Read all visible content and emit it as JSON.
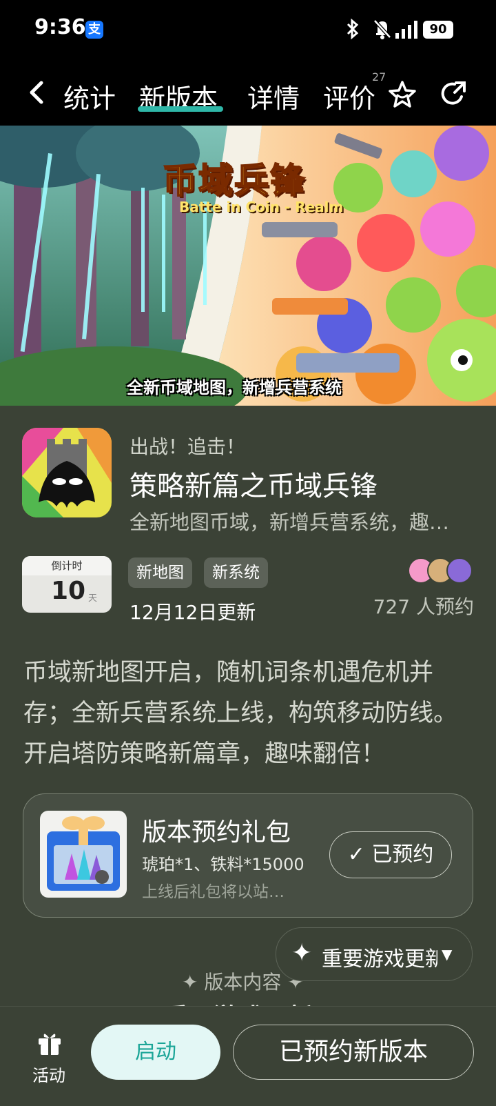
{
  "status_bar": {
    "time": "9:36",
    "alipay_glyph": "支",
    "battery": "90"
  },
  "nav": {
    "tabs": [
      {
        "label": "统计"
      },
      {
        "label": "新版本"
      },
      {
        "label": "详情"
      },
      {
        "label": "评价"
      }
    ],
    "review_badge": "27",
    "active_tab": "新版本",
    "accent": "#2fb7a8"
  },
  "banner": {
    "title": "币域兵锋",
    "subtitle": "Batte in Coin - Realm",
    "caption": "全新币域地图，新增兵营系统"
  },
  "event": {
    "pre_title": "出战！追击！",
    "title": "策略新篇之币域兵锋",
    "subtitle": "全新地图币域，新增兵营系统，趣味翻倍",
    "countdown_label": "倒计时",
    "countdown_value": "10",
    "countdown_unit": "天",
    "tags": [
      "新地图",
      "新系统"
    ],
    "update_date": "12月12日更新",
    "reserve_count": "727 人预约",
    "description": "币域新地图开启，随机词条机遇危机并存；全新兵营系统上线，构筑移动防线。开启塔防策略新篇章，趣味翻倍！"
  },
  "gift": {
    "title": "版本预约礼包",
    "items": "琥珀*1、铁料*15000",
    "note": "上线后礼包将以站…",
    "button_label": "已预约",
    "button_check": "✓"
  },
  "float_pill": {
    "label": "重要游戏更新",
    "star": "✦",
    "caret": "▼"
  },
  "section": {
    "heading": "✦ 版本内容 ✦",
    "sub": "重要游戏更新"
  },
  "bottom_bar": {
    "activity_label": "活动",
    "launch_label": "启动",
    "reserved_label": "已预约新版本"
  }
}
